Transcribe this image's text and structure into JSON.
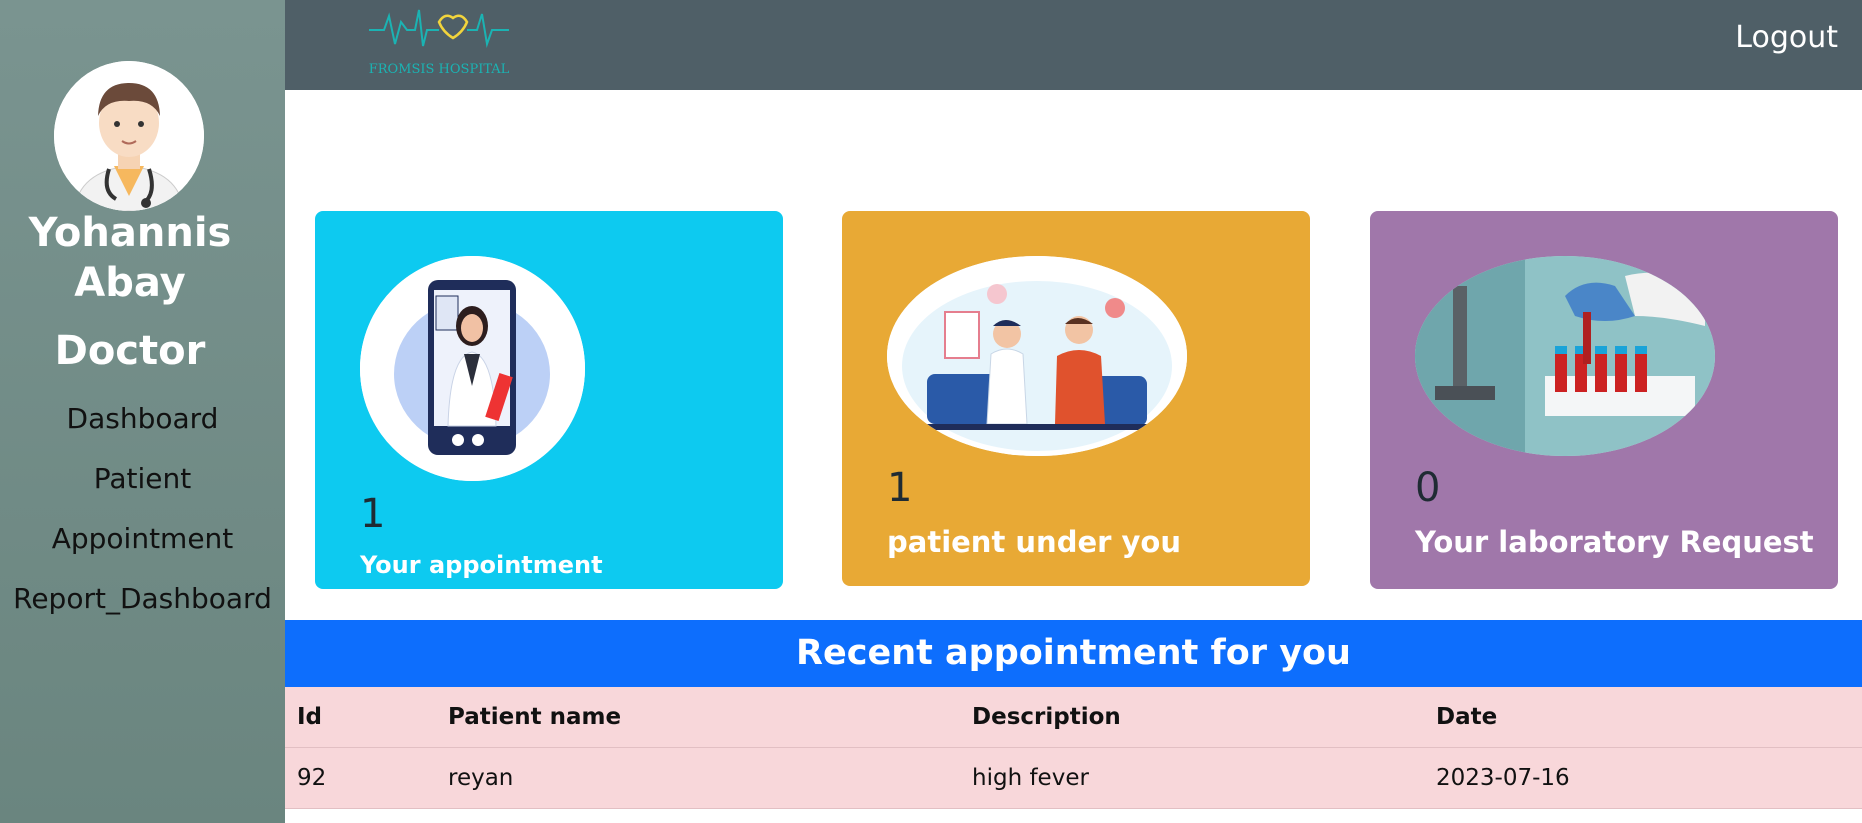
{
  "sidebar": {
    "user_name": "Yohannis Abay",
    "user_role": "Doctor",
    "nav": [
      "Dashboard",
      "Patient",
      "Appointment",
      "Report_Dashboard"
    ]
  },
  "topbar": {
    "logo_text": "FROMSIS HOSPITAL",
    "logout_label": "Logout"
  },
  "cards": [
    {
      "count": "1",
      "label": "Your appointment",
      "color": "#0dcaf0",
      "image": "video-call-doctor-illustration"
    },
    {
      "count": "1",
      "label": "patient under you",
      "color": "#e8a935",
      "image": "doctor-examining-patient-illustration"
    },
    {
      "count": "0",
      "label": "Your laboratory Request",
      "color": "#a077aa",
      "image": "lab-test-tubes-photo"
    }
  ],
  "recent": {
    "title": "Recent appointment for you",
    "columns": [
      "Id",
      "Patient name",
      "Description",
      "Date"
    ],
    "rows": [
      [
        "92",
        "reyan",
        "high fever",
        "2023-07-16"
      ]
    ]
  }
}
